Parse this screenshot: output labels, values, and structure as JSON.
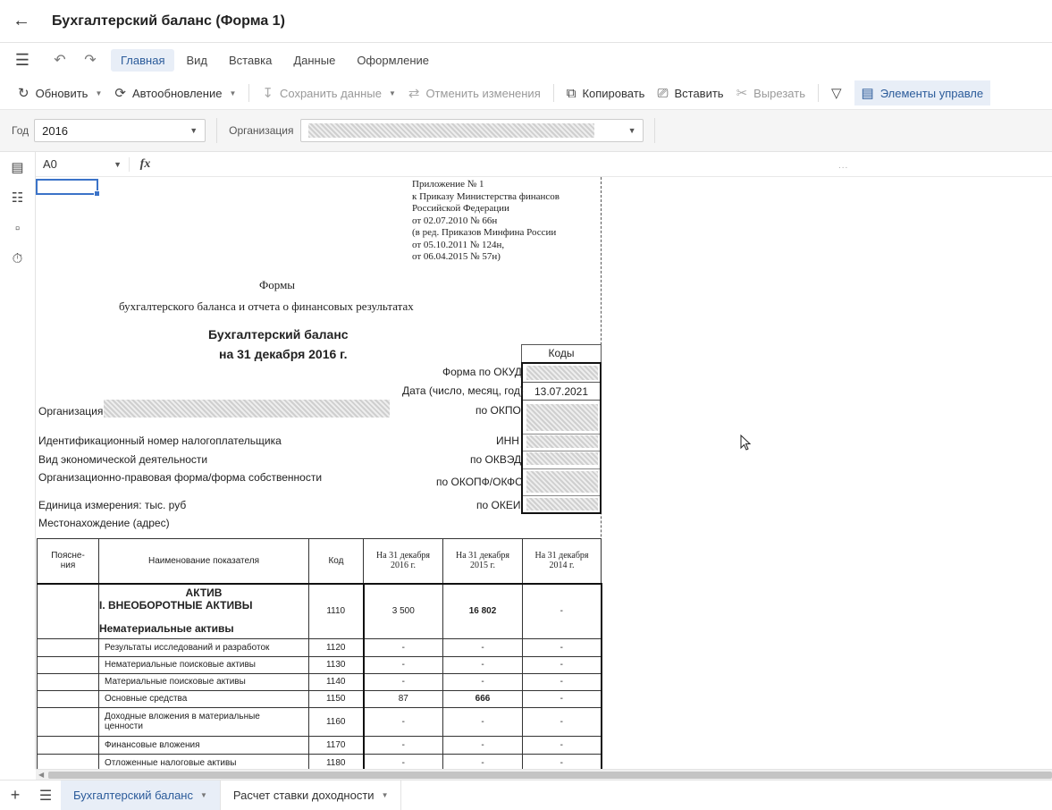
{
  "titlebar": {
    "title": "Бухгалтерский баланс (Форма 1)"
  },
  "menu": {
    "items": [
      "Главная",
      "Вид",
      "Вставка",
      "Данные",
      "Оформление"
    ],
    "active": 0
  },
  "toolbar": {
    "refresh": "Обновить",
    "autorefresh": "Автообновление",
    "save_data": "Сохранить данные",
    "cancel_changes": "Отменить изменения",
    "copy": "Копировать",
    "paste": "Вставить",
    "cut": "Вырезать",
    "controls": "Элементы управле"
  },
  "params": {
    "year_label": "Год",
    "year_value": "2016",
    "org_label": "Организация"
  },
  "formula": {
    "cell_ref": "A0",
    "fx": "fx",
    "dots": "..."
  },
  "sheet": {
    "appendix": [
      "Приложение № 1",
      "к Приказу Министерства финансов",
      "Российской Федерации",
      "от 02.07.2010 № 66н",
      "(в ред. Приказов Минфина России",
      "от 05.10.2011 № 124н,",
      "от 06.04.2015 № 57н)"
    ],
    "forms_title": "Формы",
    "forms_subtitle": "бухгалтерского баланса и отчета о финансовых результатах",
    "balance_title": "Бухгалтерский баланс",
    "balance_date": "на 31 декабря  2016 г.",
    "codes_header": "Коды",
    "okud_label": "Форма по ОКУД",
    "date_label": "Дата (число, месяц, год)",
    "date_value": "13.07.2021",
    "org_label": "Организация",
    "okpo_label": "по ОКПО",
    "inn_desc": "Идентификационный номер налогоплательщика",
    "inn_label": "ИНН",
    "activity_desc": "Вид экономической деятельности",
    "okved_label": "по ОКВЭД",
    "legal_desc": "Организационно-правовая форма/форма собственности",
    "okopf_label": "по ОКОПФ/ОКФС",
    "unit_desc": "Единица измерения: тыс. руб",
    "okei_label": "по ОКЕИ",
    "address_desc": "Местонахождение (адрес)"
  },
  "table": {
    "headers": {
      "note": "Поясне-ния",
      "name": "Наименование показателя",
      "code": "Код",
      "y2016a": "На 31 декабря",
      "y2016b": "2016 г.",
      "y2015a": "На 31 декабря",
      "y2015b": "2015 г.",
      "y2014a": "На 31 декабря",
      "y2014b": "2014 г."
    },
    "section": {
      "aktiv": "АКТИВ",
      "razdel": "I. ВНЕОБОРОТНЫЕ АКТИВЫ",
      "subhead": "Нематериальные активы",
      "code": "1110",
      "v2016": "3 500",
      "v2015": "16 802",
      "v2014": "-"
    },
    "rows": [
      {
        "name": "Результаты исследований и разработок",
        "code": "1120",
        "v2016": "-",
        "v2015": "-",
        "v2014": "-"
      },
      {
        "name": "Нематериальные поисковые активы",
        "code": "1130",
        "v2016": "-",
        "v2015": "-",
        "v2014": "-"
      },
      {
        "name": "Материальные поисковые активы",
        "code": "1140",
        "v2016": "-",
        "v2015": "-",
        "v2014": "-"
      },
      {
        "name": "Основные средства",
        "code": "1150",
        "v2016": "87",
        "v2015": "666",
        "v2014": "-"
      },
      {
        "name": "Доходные вложения в материальные ценности",
        "code": "1160",
        "v2016": "-",
        "v2015": "-",
        "v2014": "-"
      },
      {
        "name": "Финансовые вложения",
        "code": "1170",
        "v2016": "-",
        "v2015": "-",
        "v2014": "-"
      },
      {
        "name": "Отложенные налоговые активы",
        "code": "1180",
        "v2016": "-",
        "v2015": "-",
        "v2014": "-"
      }
    ]
  },
  "tabs": [
    {
      "label": "Бухгалтерский баланс",
      "active": true
    },
    {
      "label": "Расчет ставки доходности",
      "active": false
    }
  ],
  "colors": {
    "accent": "#2b5b9a",
    "active_bg": "#e8eef7",
    "selection": "#3b73c8"
  }
}
